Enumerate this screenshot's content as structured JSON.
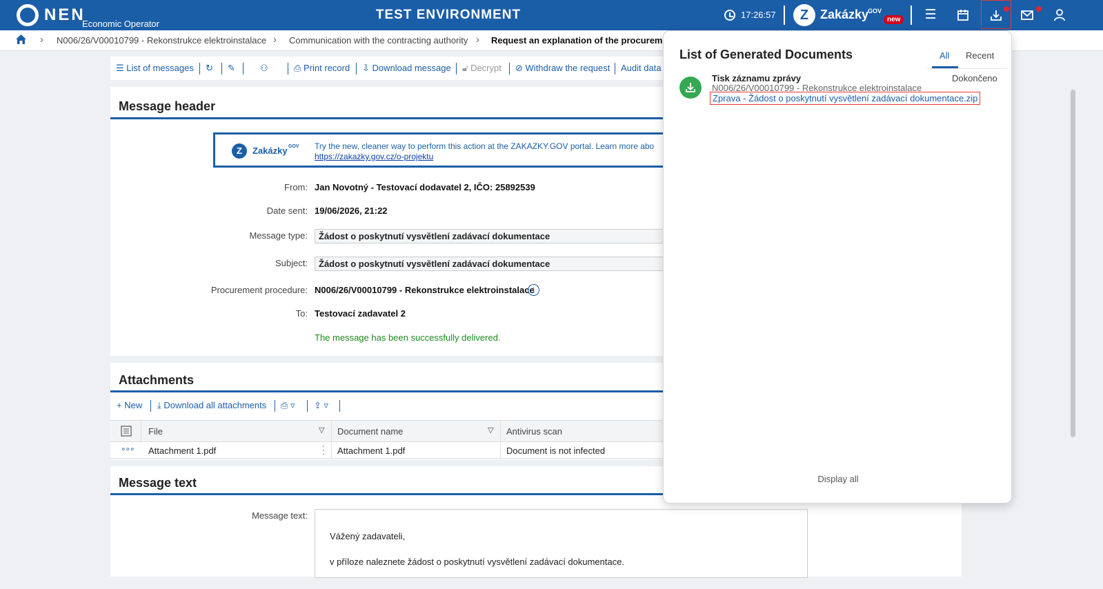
{
  "topbar": {
    "logo_text": "NEN",
    "logo_sub": "Economic Operator",
    "env_title": "TEST ENVIRONMENT",
    "clock": "17:26:57",
    "zakazky_brand": "Zakázky",
    "zakazky_gov": "GOV",
    "zakazky_new": "new",
    "icons": [
      "menu-icon",
      "calendar-icon",
      "download-icon",
      "mail-icon",
      "user-icon"
    ]
  },
  "breadcrumb": {
    "items": [
      "N006/26/V00010799 - Rekonstrukce elektroinstalace",
      "Communication with the contracting authority",
      "Request an explanation of the procurement d"
    ]
  },
  "toolbar": {
    "list_of_messages": "List of messages",
    "print_record": "Print record",
    "download_message": "Download message",
    "decrypt": "Decrypt",
    "withdraw_request": "Withdraw the request",
    "audit_data": "Audit data"
  },
  "message_header": {
    "title": "Message header",
    "promo": {
      "brand": "Zakázky",
      "brand_gov": "GOV",
      "text": "Try the new, cleaner way to perform this action at the ZAKAZKY.GOV portal. Learn more abo",
      "link": "https://zakazky.gov.cz/o-projektu"
    },
    "fields": {
      "from_label": "From:",
      "from_value": "Jan Novotný - Testovací dodavatel 2, IČO: 25892539",
      "date_label": "Date sent:",
      "date_value": "19/06/2026, 21:22",
      "type_label": "Message type:",
      "type_value": "Žádost o poskytnutí vysvětlení zadávací dokumentace",
      "subject_label": "Subject:",
      "subject_value": "Žádost o poskytnutí vysvětlení zadávací dokumentace",
      "procedure_label": "Procurement procedure:",
      "procedure_value": "N006/26/V00010799 - Rekonstrukce elektroinstalace",
      "to_label": "To:",
      "to_value": "Testovací zadavatel 2"
    },
    "success": "The message has been successfully delivered."
  },
  "attachments": {
    "title": "Attachments",
    "new_label": "New",
    "download_all": "Download all attachments",
    "columns": [
      "File",
      "Document name",
      "Antivirus scan"
    ],
    "rows": [
      {
        "file": "Attachment 1.pdf",
        "name": "Attachment 1.pdf",
        "scan": "Document is not infected"
      }
    ]
  },
  "message_text": {
    "title": "Message text",
    "label": "Message text:",
    "line1": "Vážený zadavateli,",
    "line2": "v příloze naleznete žádost o poskytnutí vysvětlení zadávací dokumentace."
  },
  "popup": {
    "title": "List of Generated Documents",
    "tab_all": "All",
    "tab_recent": "Recent",
    "doc": {
      "name": "Tisk záznamu zprávy",
      "status": "Dokončeno",
      "sub": "N006/26/V00010799 - Rekonstrukce elektroinstalace",
      "link": "Zprava - Žádost o poskytnutí vysvětlení zadávací dokumentace.zip"
    },
    "display_all": "Display all"
  },
  "colors": {
    "brand_blue": "#1b5ea8",
    "success_green": "#1e8a1e",
    "alert_red": "#e3262b"
  }
}
